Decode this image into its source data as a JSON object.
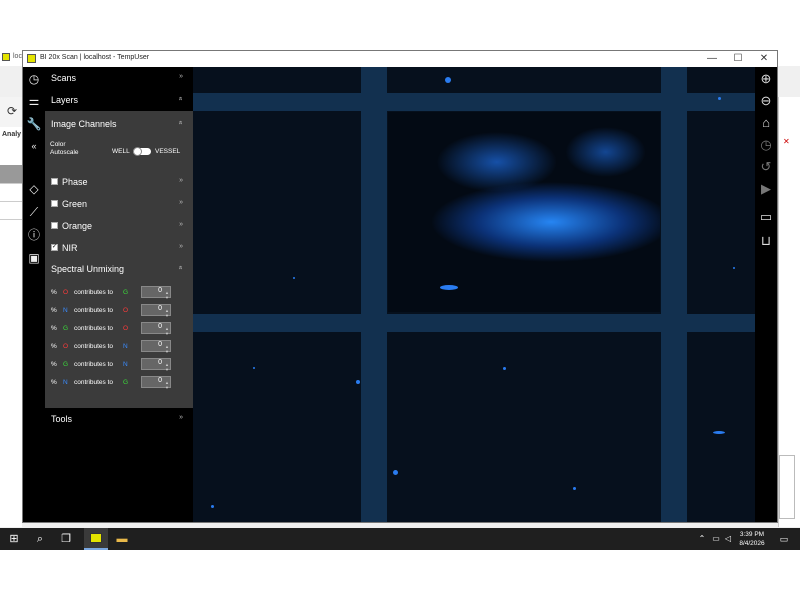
{
  "window": {
    "title": "BI 20x Scan | localhost - TempUser",
    "minimize": "—",
    "maximize": "☐",
    "close": "✕"
  },
  "background_app": {
    "tab_fragment": "loc",
    "sidebar_label": "Analy"
  },
  "panel": {
    "scans_label": "Scans",
    "layers_label": "Layers",
    "image_channels_label": "Image Channels",
    "color_autoscale_label_1": "Color",
    "color_autoscale_label_2": "Autoscale",
    "toggle_left": "WELL",
    "toggle_right": "VESSEL",
    "collapse_glyph": "«",
    "channels": [
      {
        "label": "Phase",
        "checked": false
      },
      {
        "label": "Green",
        "checked": false
      },
      {
        "label": "Orange",
        "checked": false
      },
      {
        "label": "NIR",
        "checked": true
      }
    ],
    "spectral_unmixing_label": "Spectral Unmixing",
    "unmix_rows": [
      {
        "pct": "%",
        "from": "O",
        "from_color": "R",
        "text": "contributes to",
        "to": "G",
        "to_color": "G",
        "value": "0"
      },
      {
        "pct": "%",
        "from": "N",
        "from_color": "N",
        "text": "contributes to",
        "to": "O",
        "to_color": "R",
        "value": "0"
      },
      {
        "pct": "%",
        "from": "G",
        "from_color": "G",
        "text": "contributes to",
        "to": "O",
        "to_color": "R",
        "value": "0"
      },
      {
        "pct": "%",
        "from": "O",
        "from_color": "R",
        "text": "contributes to",
        "to": "N",
        "to_color": "N",
        "value": "0"
      },
      {
        "pct": "%",
        "from": "G",
        "from_color": "G",
        "text": "contributes to",
        "to": "N",
        "to_color": "N",
        "value": "0"
      },
      {
        "pct": "%",
        "from": "N",
        "from_color": "N",
        "text": "contributes to",
        "to": "G",
        "to_color": "G",
        "value": "0"
      }
    ],
    "tools_label": "Tools"
  },
  "clock": {
    "time": "3:39 PM",
    "date": "8/4/2026"
  },
  "colors": {
    "accent_blue": "#2a7cf0",
    "panel_gray": "#3b3b3b",
    "grid_lines": "#12304f"
  }
}
